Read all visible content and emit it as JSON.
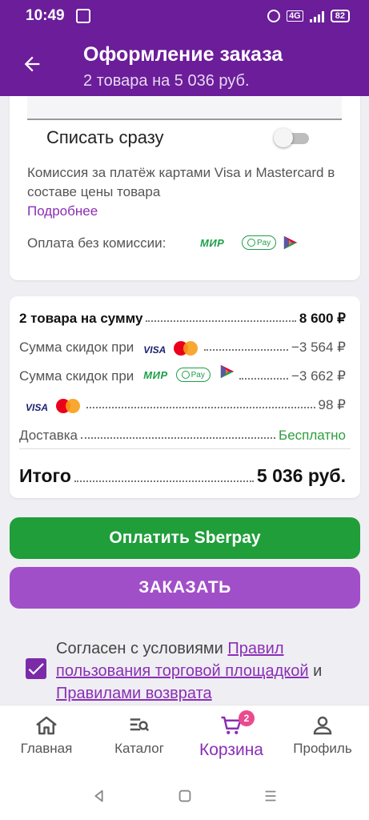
{
  "status_bar": {
    "time": "10:49",
    "network": "4G",
    "battery": "82"
  },
  "header": {
    "title": "Оформление заказа",
    "subtitle": "2 товара на 5 036 руб."
  },
  "payment": {
    "toggle_label": "Списать сразу",
    "toggle_on": false,
    "commission_text": "Комиссия за платёж картами Visa и Mastercard в составе цены товара",
    "more_link": "Подробнее",
    "no_commission_label": "Оплата без комиссии:",
    "mir": "МИР",
    "sberpay": "Pay"
  },
  "summary": {
    "items_label": "2 товара на сумму",
    "items_value": "8 600 ₽",
    "discount_label_1": "Сумма скидок при",
    "visa_1": "VISA",
    "discount_value_1": "−3 564 ₽",
    "discount_label_2": "Сумма скидок при",
    "mir_2": "МИР",
    "sberpay_2": "Pay",
    "discount_value_2": "−3 662 ₽",
    "visa_3": "VISA",
    "card_value": "98 ₽",
    "delivery_label": "Доставка",
    "delivery_value": "Бесплатно",
    "total_label": "Итого",
    "total_value": "5 036 руб."
  },
  "buttons": {
    "sberpay": "Оплатить Sberpay",
    "order": "ЗАКАЗАТЬ"
  },
  "agreement": {
    "text_before": "Согласен с условиями ",
    "link1": "Правил пользования торговой площадкой",
    "text_mid": " и ",
    "link2": "Правилами возврата",
    "checked": true
  },
  "nav": {
    "home": "Главная",
    "catalog": "Каталог",
    "cart": "Корзина",
    "cart_badge": "2",
    "profile": "Профиль"
  },
  "colors": {
    "brand": "#6b1d9a",
    "accent": "#8a2fb5",
    "green": "#1f9e3a"
  }
}
